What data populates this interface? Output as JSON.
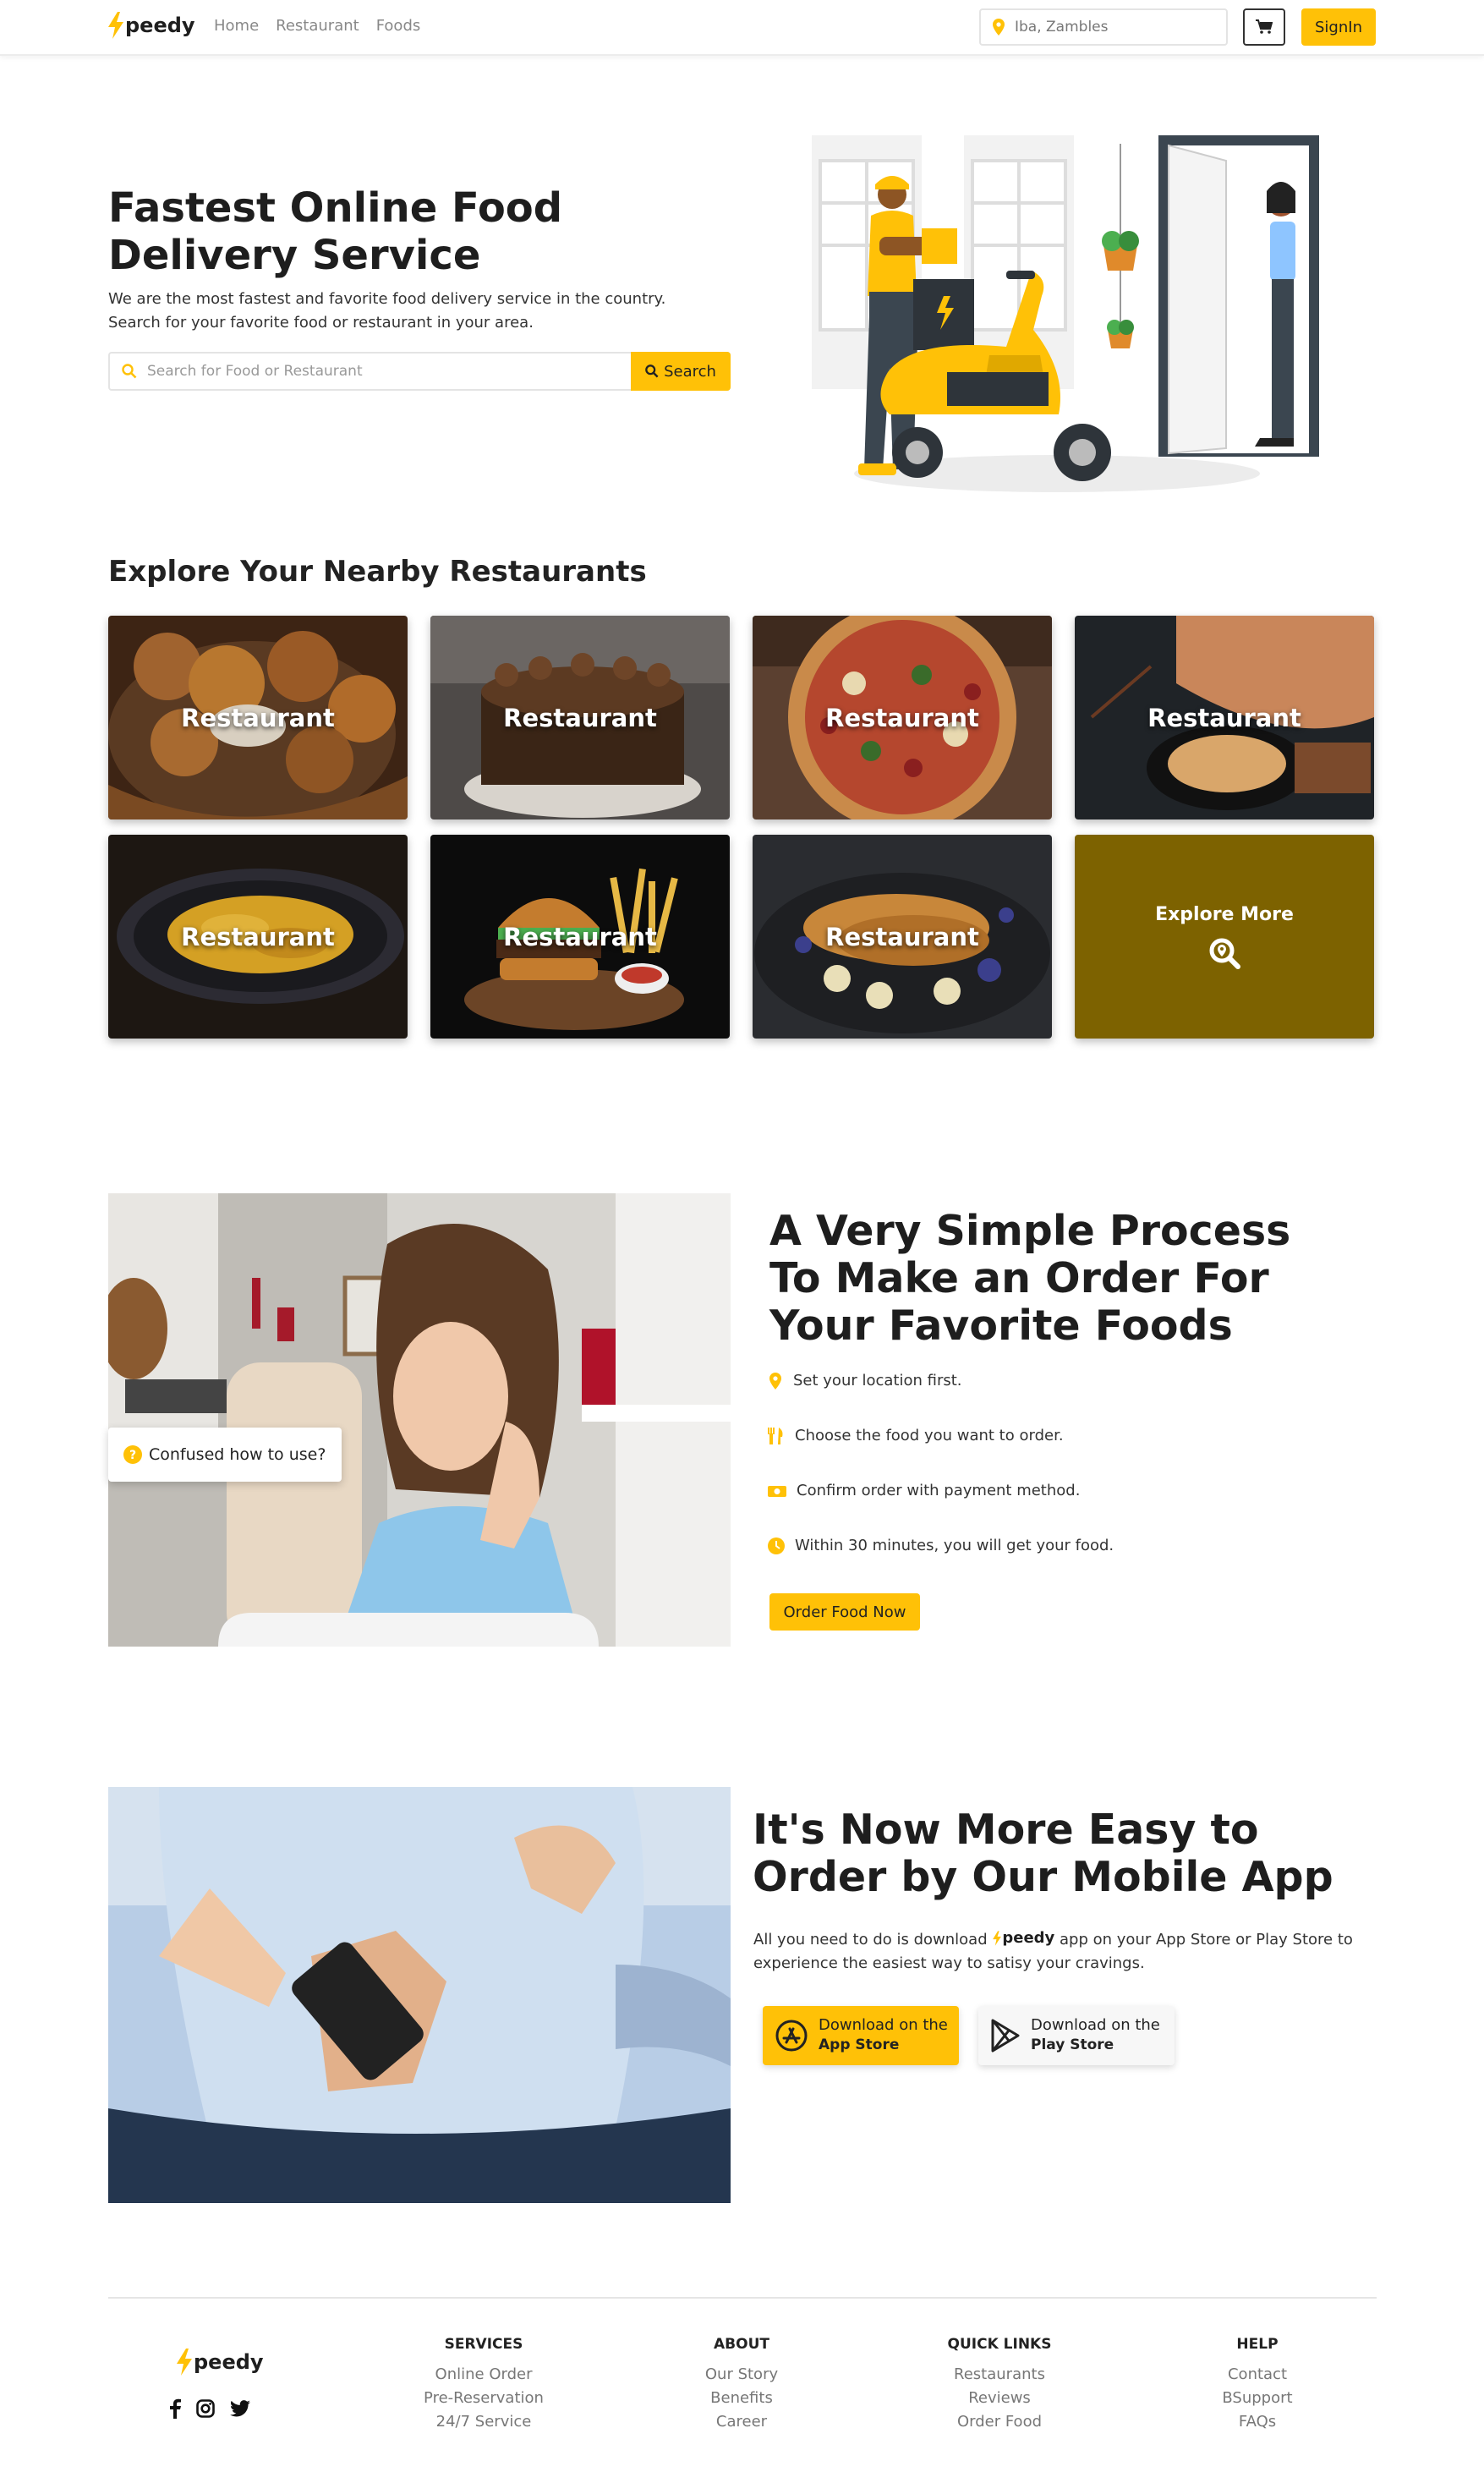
{
  "brand": {
    "name": "peedy",
    "accent": "#ffc107",
    "explore_bg": "#7d6200"
  },
  "nav": {
    "links": [
      "Home",
      "Restaurant",
      "Foods"
    ],
    "location": "Iba, Zambles",
    "location_icon": "map-pin-icon",
    "cart_icon": "cart-icon",
    "signin_label": "SignIn"
  },
  "hero": {
    "title": "Fastest Online Food Delivery Service",
    "subtitle": "We are the most fastest and favorite food delivery service in the country. Search for your favorite food or restaurant in your area.",
    "search_placeholder": "Search for Food or Restaurant",
    "search_button": "Search",
    "illustration": "delivery-scooter-illustration"
  },
  "restaurants": {
    "title": "Explore Your Nearby Restaurants",
    "cards": [
      {
        "label": "Restaurant",
        "photo": "fried-chicken"
      },
      {
        "label": "Restaurant",
        "photo": "chocolate-cake"
      },
      {
        "label": "Restaurant",
        "photo": "pizza"
      },
      {
        "label": "Restaurant",
        "photo": "noodles"
      },
      {
        "label": "Restaurant",
        "photo": "pasta"
      },
      {
        "label": "Restaurant",
        "photo": "burger-fries"
      },
      {
        "label": "Restaurant",
        "photo": "pancakes"
      }
    ],
    "explore_label": "Explore More",
    "explore_icon": "search-location-icon"
  },
  "process": {
    "photo": "confused-woman-laptop",
    "badge": "Confused how to use?",
    "title": "A Very Simple Process To Make an Order For Your Favorite Foods",
    "steps": [
      {
        "icon": "map-pin-icon",
        "text": "Set your location first."
      },
      {
        "icon": "utensils-icon",
        "text": "Choose the food you want to order."
      },
      {
        "icon": "money-icon",
        "text": "Confirm order with payment method."
      },
      {
        "icon": "clock-icon",
        "text": "Within 30 minutes, you will get your food."
      }
    ],
    "button": "Order Food Now"
  },
  "app": {
    "photo": "man-holding-phone",
    "title": "It's Now More Easy to Order by Our Mobile App",
    "desc_before": "All you need to do is download",
    "desc_brand": "peedy",
    "desc_after": "app on your App Store or Play Store to experience the easiest way to satisy your cravings.",
    "appstore": {
      "line1": "Download on the",
      "line2": "App Store"
    },
    "playstore": {
      "line1": "Download on the",
      "line2": "Play Store"
    }
  },
  "footer": {
    "brand": "peedy",
    "socials": [
      "facebook-icon",
      "instagram-icon",
      "twitter-icon"
    ],
    "columns": [
      {
        "title": "SERVICES",
        "items": [
          "Online Order",
          "Pre-Reservation",
          "24/7 Service"
        ]
      },
      {
        "title": "ABOUT",
        "items": [
          "Our Story",
          "Benefits",
          "Career"
        ]
      },
      {
        "title": "QUICK LINKS",
        "items": [
          "Restaurants",
          "Reviews",
          "Order Food"
        ]
      },
      {
        "title": "HELP",
        "items": [
          "Contact",
          "BSupport",
          "FAQs"
        ]
      }
    ]
  }
}
